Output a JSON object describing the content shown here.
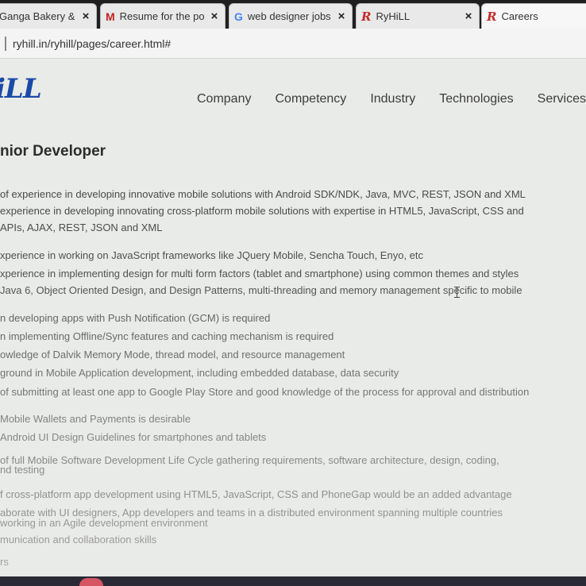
{
  "browser": {
    "tabs": [
      {
        "title": "Ganga Bakery & S",
        "icon": "site-favicon",
        "active": false
      },
      {
        "title": "Resume for the po",
        "icon": "gmail-icon",
        "active": false
      },
      {
        "title": "web designer jobs",
        "icon": "google-icon",
        "active": false
      },
      {
        "title": "RyHiLL",
        "icon": "ryhill-icon",
        "active": false
      },
      {
        "title": "Careers",
        "icon": "ryhill-icon",
        "active": true
      }
    ],
    "close_glyph": "×",
    "url": "ryhill.in/ryhill/pages/career.html#"
  },
  "site": {
    "logo_text": "iLL",
    "nav": [
      "Company",
      "Competency",
      "Industry",
      "Technologies",
      "Services"
    ]
  },
  "job": {
    "title": "nior Developer",
    "requirements": [
      "of experience in developing innovative mobile solutions with Android SDK/NDK, Java, MVC, REST, JSON and XML",
      "experience in developing innovating cross-platform mobile solutions with expertise in HTML5, JavaScript, CSS and",
      "APIs, AJAX, REST, JSON and XML",
      "xperience in working on JavaScript frameworks like JQuery Mobile, Sencha Touch, Enyo, etc",
      "xperience in implementing design for multi form factors (tablet and smartphone) using common themes and styles",
      "Java 6, Object Oriented Design, and Design Patterns, multi-threading and memory management specific to mobile",
      "n developing apps with Push Notification (GCM) is required",
      "n implementing Offline/Sync features and caching mechanism is required",
      "owledge of Dalvik Memory Mode, thread model, and resource management",
      "ground in Mobile Application development, including embedded database, data security",
      "of submitting at least one app to Google Play Store and good knowledge of the process for approval and distribution",
      "Mobile Wallets and Payments is desirable",
      "Android UI Design Guidelines for smartphones and tablets",
      "of full Mobile Software Development Life Cycle gathering requirements, software architecture, design, coding,",
      "nd testing",
      "f cross-platform app development using HTML5, JavaScript, CSS and PhoneGap would be an added advantage",
      "aborate with UI designers, App developers and teams in a distributed environment spanning multiple countries",
      "working in an Agile development environment",
      "munication and collaboration skills",
      "rs"
    ]
  },
  "colors": {
    "logo": "#1a4aa8",
    "ryhill_red": "#c62828",
    "text_dark": "#3c3c3c",
    "page_bg": "#e9ebe8"
  }
}
